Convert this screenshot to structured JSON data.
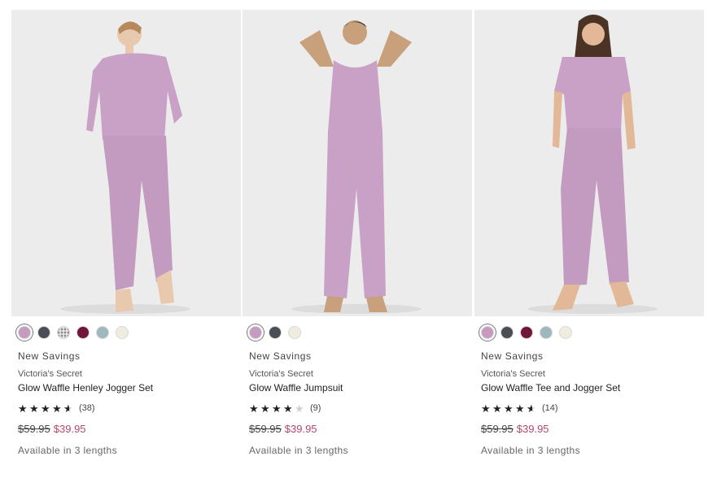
{
  "products": [
    {
      "swatches": [
        {
          "color": "#c79ac0",
          "selected": true
        },
        {
          "color": "#4b4f55"
        },
        {
          "color": "plaid"
        },
        {
          "color": "#72153a"
        },
        {
          "color": "#9fb8be"
        },
        {
          "color": "#f1ece0"
        }
      ],
      "badge": "New Savings",
      "brand": "Victoria's Secret",
      "name": "Glow Waffle Henley Jogger Set",
      "rating": 4.5,
      "review_count": "(38)",
      "old_price": "$59.95",
      "sale_price": "$39.95",
      "lengths_note": "Available in 3 lengths"
    },
    {
      "swatches": [
        {
          "color": "#c79ac0",
          "selected": true
        },
        {
          "color": "#4b4f55"
        },
        {
          "color": "#f1ece0"
        }
      ],
      "badge": "New Savings",
      "brand": "Victoria's Secret",
      "name": "Glow Waffle Jumpsuit",
      "rating": 4,
      "review_count": "(9)",
      "old_price": "$59.95",
      "sale_price": "$39.95",
      "lengths_note": "Available in 3 lengths"
    },
    {
      "swatches": [
        {
          "color": "#c79ac0",
          "selected": true
        },
        {
          "color": "#4b4f55"
        },
        {
          "color": "#72153a"
        },
        {
          "color": "#9fb8be"
        },
        {
          "color": "#f1ece0"
        }
      ],
      "badge": "New Savings",
      "brand": "Victoria's Secret",
      "name": "Glow Waffle Tee and Jogger Set",
      "rating": 4.5,
      "review_count": "(14)",
      "old_price": "$59.95",
      "sale_price": "$39.95",
      "lengths_note": "Available in 3 lengths"
    }
  ],
  "colors": {
    "sale_price": "#b04a6b",
    "outfit": "#c9a0c6",
    "photo_bg": "#ececec"
  }
}
